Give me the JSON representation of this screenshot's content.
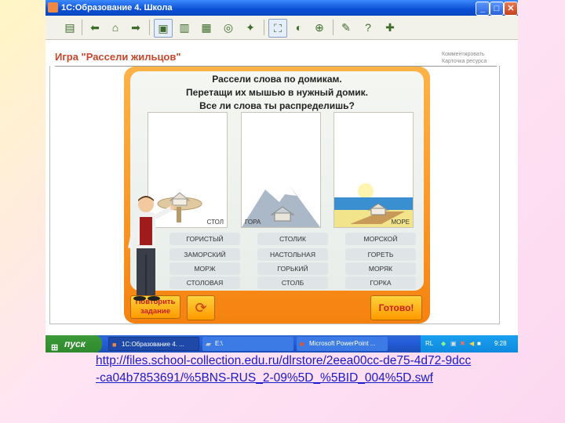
{
  "window": {
    "title": "1С:Образование 4. Школа",
    "minimize_glyph": "_",
    "maximize_glyph": "□",
    "close_glyph": "✕"
  },
  "toolbar": {
    "buttons": [
      "document-icon",
      "back-arrow-icon",
      "home-icon",
      "forward-arrow-icon",
      "page-icon",
      "book-icon",
      "print-icon",
      "globe-icon",
      "bookmark-icon",
      "fullscreen-icon",
      "search-icon",
      "zoom-icon",
      "pen-icon",
      "help-icon",
      "tools-icon"
    ]
  },
  "page": {
    "title": "Игра \"Рассели жильцов\"",
    "link_comment": "Комментировать",
    "link_card": "Карточка ресурса"
  },
  "game": {
    "instruction_lines": [
      "Рассели слова по домикам.",
      "Перетащи их мышью в нужный домик.",
      "Все ли слова ты распределишь?"
    ],
    "houses": [
      {
        "label": "СТОЛ"
      },
      {
        "label": "ГОРА"
      },
      {
        "label": "МОРЕ"
      }
    ],
    "words": [
      [
        "ГОРИСТЫЙ",
        "СТОЛИК",
        "МОРСКОЙ"
      ],
      [
        "ЗАМОРСКИЙ",
        "НАСТОЛЬНАЯ",
        "ГОРЕТЬ"
      ],
      [
        "МОРЖ",
        "ГОРЬКИЙ",
        "МОРЯК"
      ],
      [
        "СТОЛОВАЯ",
        "СТОЛБ",
        "ГОРКА"
      ]
    ],
    "repeat_line1": "Повторить",
    "repeat_line2": "задание",
    "reload_glyph": "⟳",
    "ready_label": "Готово!"
  },
  "taskbar": {
    "start_label": "пуск",
    "start_flag": "⊞",
    "tasks": [
      {
        "label": "1С:Образование 4. ...",
        "icon": "app-icon",
        "glyph": "■"
      },
      {
        "label": "E:\\",
        "icon": "folder-icon",
        "glyph": "▰"
      },
      {
        "label": "Microsoft PowerPoint ...",
        "icon": "powerpoint-icon",
        "glyph": "■"
      }
    ],
    "lang": "RL",
    "clock": "9:28"
  },
  "link": {
    "url": "http://files.school-collection.edu.ru/dlrstore/2eea00cc-de75-4d72-9dcc-ca04b7853691/%5BNS-RUS_2-09%5D_%5BID_004%5D.swf"
  },
  "colors": {
    "accent": "#f5820f",
    "title_red": "#c8462c",
    "link_blue": "#1a1acc"
  }
}
